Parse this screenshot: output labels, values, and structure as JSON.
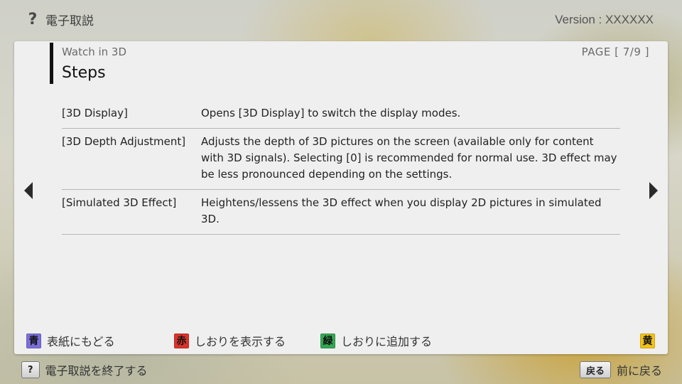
{
  "header": {
    "help_glyph": "?",
    "app_title": "電子取説",
    "version": "Version : XXXXXX"
  },
  "content": {
    "section": "Watch in 3D",
    "title": "Steps",
    "page_indicator": "PAGE [ 7/9 ]",
    "rows": [
      {
        "label": "[3D Display]",
        "desc": "Opens [3D Display] to switch the display modes."
      },
      {
        "label": "[3D Depth Adjustment]",
        "desc": "Adjusts the depth of 3D pictures on the screen (available only for content with 3D signals). Selecting [0] is recommended for normal use. 3D effect may be less pronounced depending on the settings."
      },
      {
        "label": "[Simulated 3D Effect]",
        "desc": "Heightens/lessens the 3D effect when you display 2D pictures in simulated 3D."
      }
    ]
  },
  "color_keys": {
    "blue": {
      "badge": "青",
      "label": "表紙にもどる",
      "color": "#7a6fd8"
    },
    "red": {
      "badge": "赤",
      "label": "しおりを表示する",
      "color": "#d9332b"
    },
    "green": {
      "badge": "緑",
      "label": "しおりに追加する",
      "color": "#34a853"
    },
    "yellow": {
      "badge": "黄",
      "label": "",
      "color": "#f2c21a"
    }
  },
  "footer": {
    "exit_key": "?",
    "exit_label": "電子取説を終了する",
    "back_key": "戻る",
    "back_label": "前に戻る"
  },
  "icons": {
    "prev": "triangle-left-icon",
    "next": "triangle-right-icon",
    "help": "question-mark-icon"
  }
}
